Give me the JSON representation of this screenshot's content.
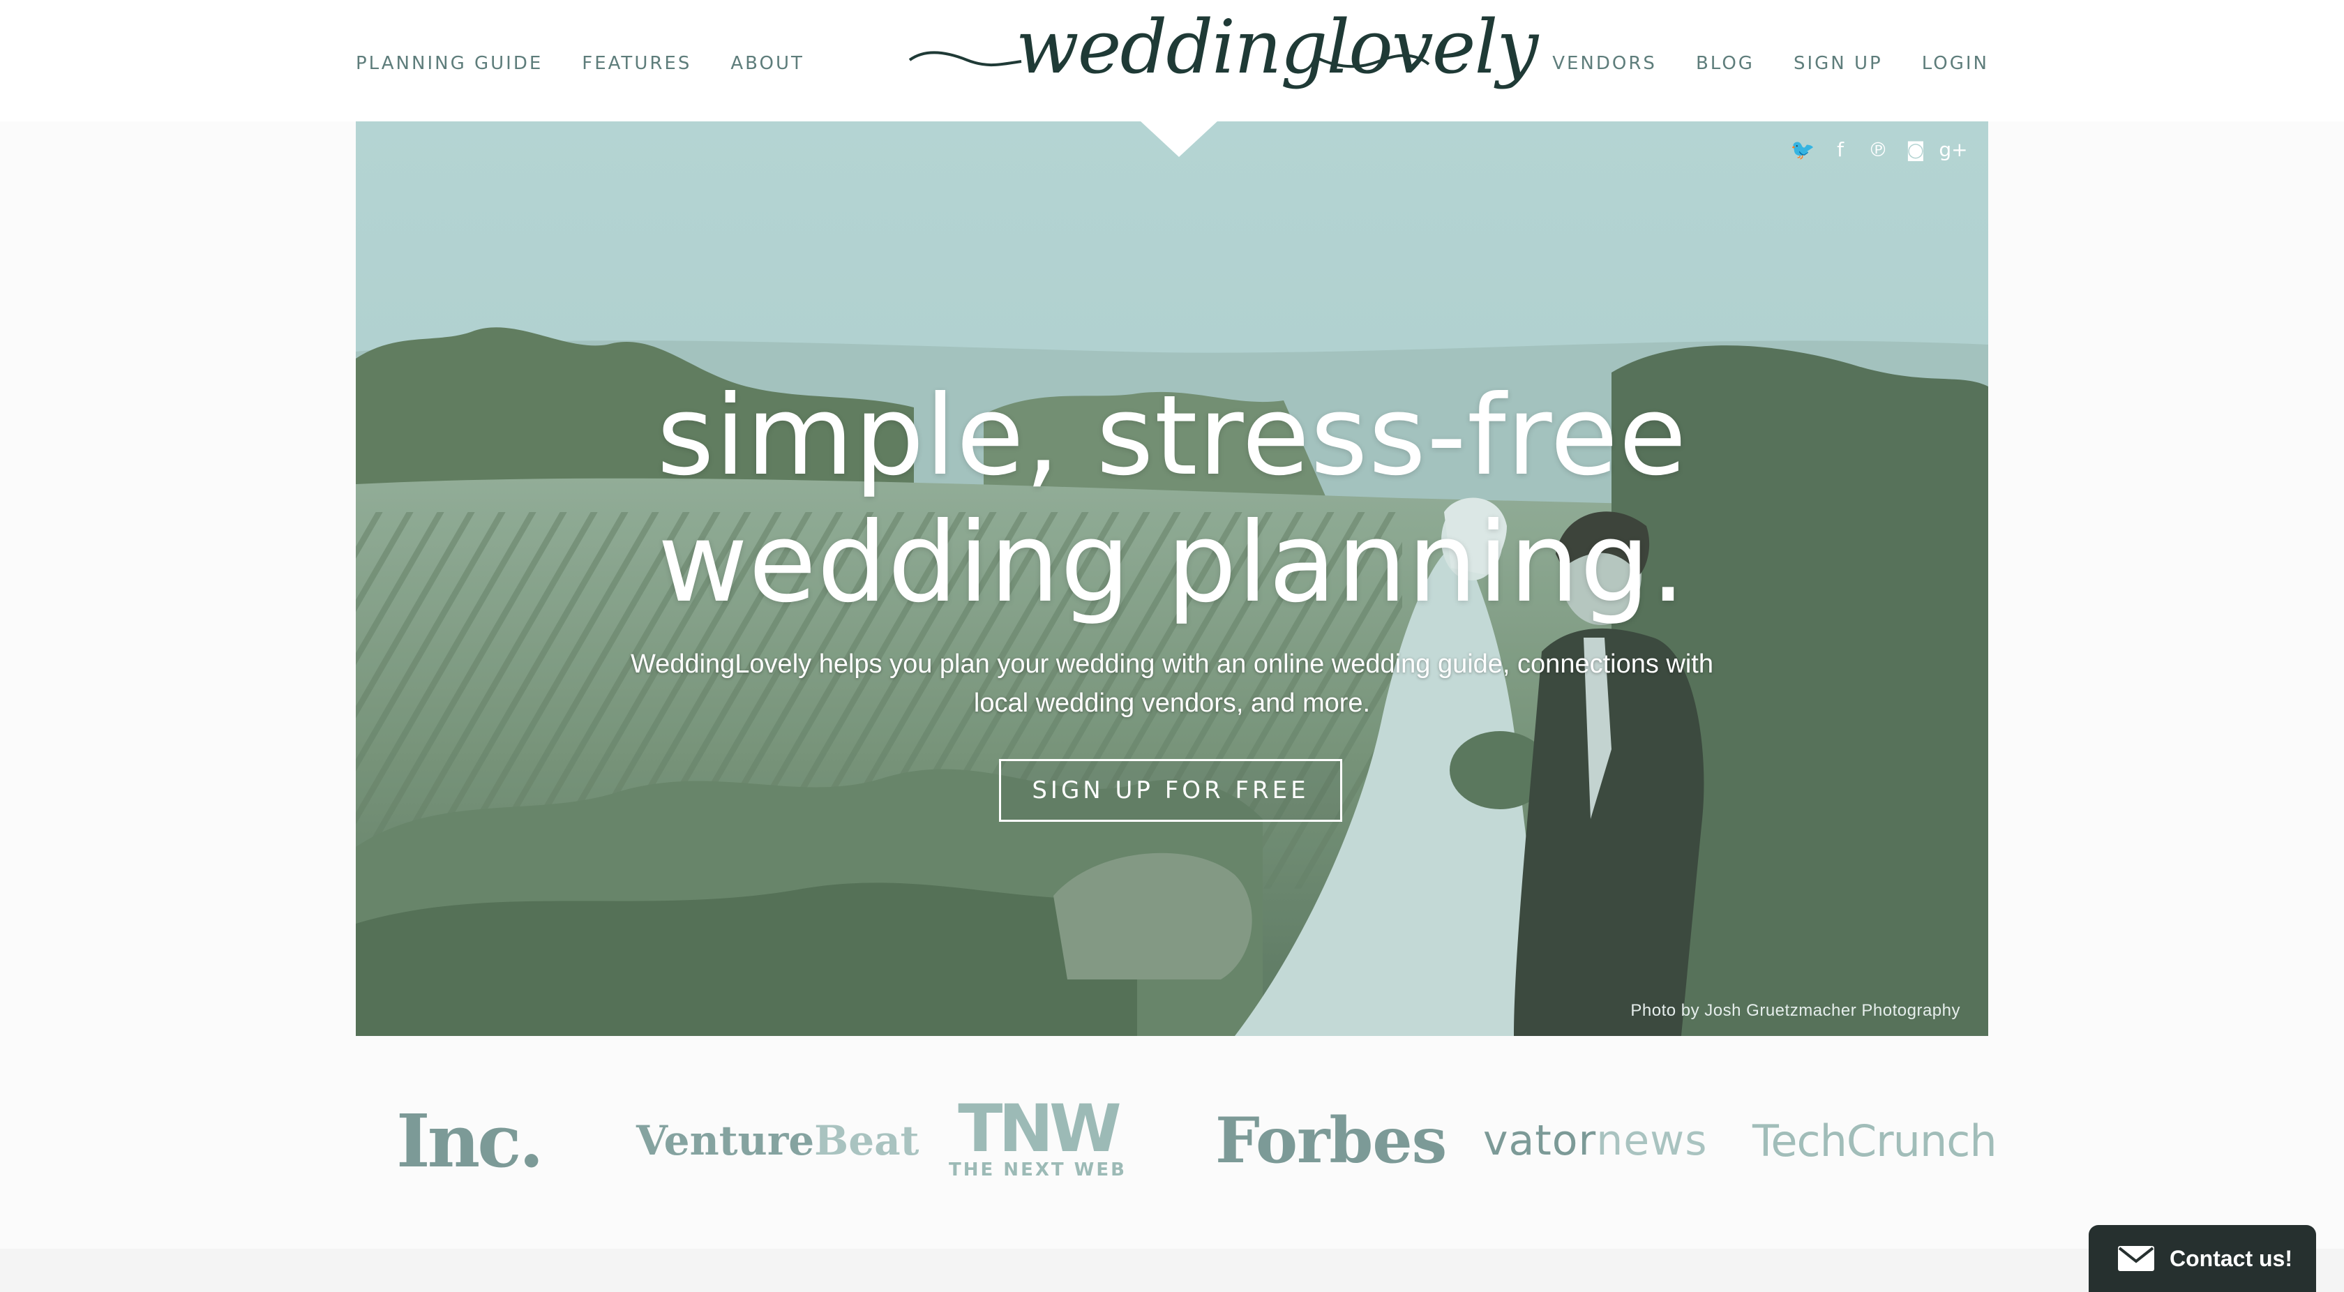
{
  "nav": {
    "left": [
      "PLANNING GUIDE",
      "FEATURES",
      "ABOUT"
    ],
    "right": [
      "VENDORS",
      "BLOG",
      "SIGN UP",
      "LOGIN"
    ]
  },
  "logo": {
    "text": "weddinglovely"
  },
  "social": [
    {
      "icon": "twitter-icon",
      "glyph": "🐦"
    },
    {
      "icon": "facebook-icon",
      "glyph": "f"
    },
    {
      "icon": "pinterest-icon",
      "glyph": "℗"
    },
    {
      "icon": "instagram-icon",
      "glyph": "◙"
    },
    {
      "icon": "google-plus-icon",
      "glyph": "g+"
    }
  ],
  "hero": {
    "headline_line1": "simple, stress-free",
    "headline_line2": "wedding planning.",
    "subtitle_line1": "WeddingLovely helps you plan your wedding with an online wedding guide, connections with",
    "subtitle_line2": "local wedding vendors, and more.",
    "cta": "SIGN UP FOR FREE",
    "credit": "Photo by Josh Gruetzmacher Photography"
  },
  "press": {
    "inc": "Inc.",
    "venturebeat_a": "Venture",
    "venturebeat_b": "Beat",
    "tnw_big": "TNW",
    "tnw_small": "THE NEXT WEB",
    "forbes": "Forbes",
    "vator_a": "vator",
    "vator_b": "news",
    "techcrunch": "TechCrunch"
  },
  "contact": {
    "label": "Contact us!"
  },
  "colors": {
    "accent": "#5e7d7b",
    "hero_tint": "#b4d4d3",
    "contact_bg": "#26302f"
  }
}
